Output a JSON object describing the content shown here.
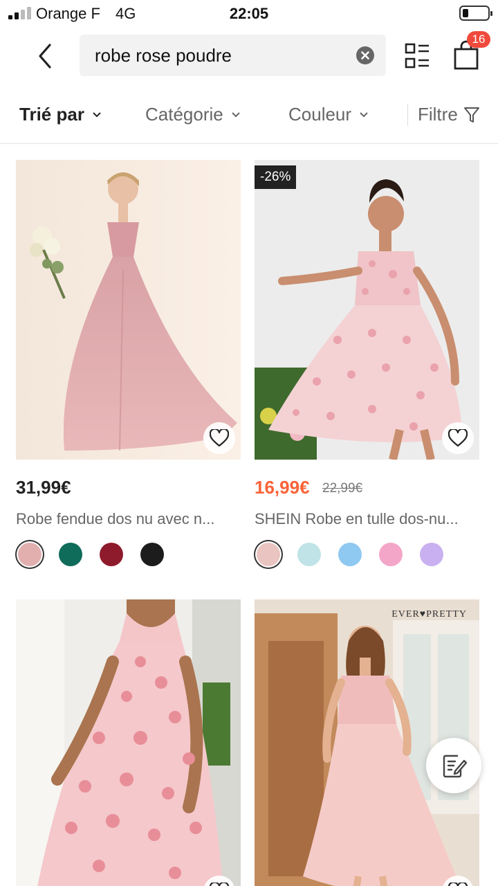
{
  "status_bar": {
    "carrier": "Orange F",
    "network": "4G",
    "time": "22:05"
  },
  "header": {
    "search_query": "robe rose poudre",
    "cart_count": "16",
    "icons": {
      "back": "chevron-left-icon",
      "clear": "clear-icon",
      "view": "grid-view-icon",
      "cart": "shopping-bag-icon"
    }
  },
  "filters": {
    "sort_label": "Trié par",
    "category_label": "Catégorie",
    "color_label": "Couleur",
    "filter_label": "Filtre"
  },
  "products": [
    {
      "price": "31,99€",
      "title": "Robe fendue dos nu avec n...",
      "swatches": [
        "#e2aeae",
        "#0f6b5a",
        "#8e1b2c",
        "#1c1c1c"
      ]
    },
    {
      "discount": "-26%",
      "price": "16,99€",
      "old_price": "22,99€",
      "title": "SHEIN Robe en tulle dos-nu...",
      "swatches": [
        "#e9c4c0",
        "#bfe3e6",
        "#8fc9f2",
        "#f4a6c8",
        "#c9b0f0"
      ]
    },
    {},
    {
      "brand_mark": "EVER♥PRETTY"
    }
  ],
  "colors": {
    "accent": "#fa6338",
    "badge": "#f04a3c"
  }
}
